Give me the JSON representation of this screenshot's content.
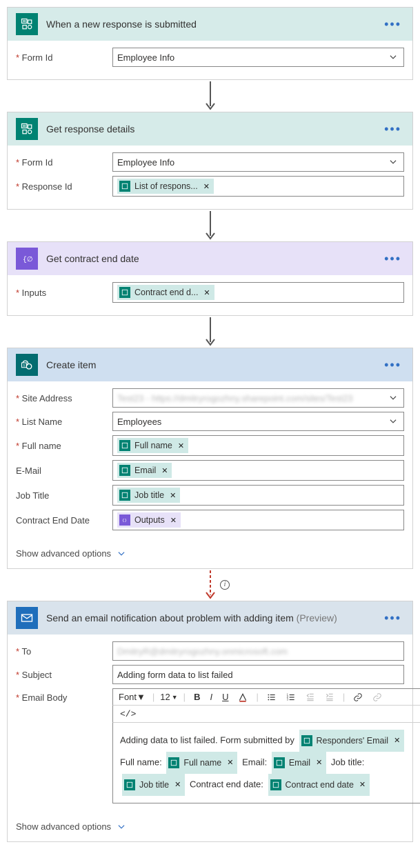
{
  "actions": {
    "trigger": {
      "title": "When a new response is submitted",
      "form_id_label": "Form Id",
      "form_id_value": "Employee Info"
    },
    "details": {
      "title": "Get response details",
      "form_id_label": "Form Id",
      "form_id_value": "Employee Info",
      "response_id_label": "Response Id",
      "response_token": "List of respons..."
    },
    "compose": {
      "title": "Get contract end date",
      "inputs_label": "Inputs",
      "inputs_token": "Contract end d..."
    },
    "create": {
      "title": "Create item",
      "site_label": "Site Address",
      "site_value": "Test23 - https://dmitryrogozhny.sharepoint.com/sites/Test23",
      "list_label": "List Name",
      "list_value": "Employees",
      "fullname_label": "Full name",
      "fullname_token": "Full name",
      "email_label": "E-Mail",
      "email_token": "Email",
      "jobtitle_label": "Job Title",
      "jobtitle_token": "Job title",
      "contract_label": "Contract End Date",
      "contract_token": "Outputs",
      "advanced": "Show advanced options"
    },
    "email": {
      "title": "Send an email notification about problem with adding item",
      "preview": "(Preview)",
      "to_label": "To",
      "to_value": "DmitryR@dmitryrogozhny.onmicrosoft.com",
      "subject_label": "Subject",
      "subject_value": "Adding form data to list failed",
      "body_label": "Email Body",
      "font_label": "Font",
      "font_size": "12",
      "body_text_1": "Adding data to list failed. Form submitted by",
      "responders_token": "Responders' Email",
      "fullname_text": "Full name:",
      "fullname_token": "Full name",
      "email_text": "Email:",
      "email_token": "Email",
      "jobtitle_text": "Job title:",
      "jobtitle_token": "Job title",
      "contract_text": "Contract end date:",
      "contract_token": "Contract end date",
      "advanced": "Show advanced options"
    }
  }
}
